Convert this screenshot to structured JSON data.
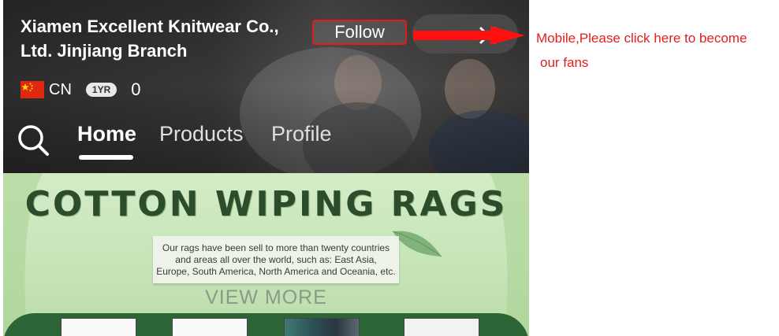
{
  "header": {
    "company_name": "Xiamen Excellent Knitwear Co., Ltd. Jinjiang Branch",
    "follow_label": "Follow",
    "country_code": "CN",
    "years_badge": "1YR",
    "fans_count": "0",
    "flag_icon": "china-flag-icon",
    "close_icon": "close-icon",
    "search_icon": "search-icon"
  },
  "tabs": [
    {
      "label": "Home",
      "active": true
    },
    {
      "label": "Products",
      "active": false
    },
    {
      "label": "Profile",
      "active": false
    }
  ],
  "banner": {
    "title": "COTTON WIPING RAGS",
    "description_lines": [
      "Our rags have been sell to more than twenty countries",
      "and areas all over the world, such as: East Asia,",
      "Europe, South America, North America and Oceania, etc."
    ],
    "view_more": "VIEW MORE"
  },
  "annotation": {
    "line1": "Mobile,Please click here to become",
    "line2": "our fans",
    "color": "#e31e1e"
  },
  "colors": {
    "follow_border": "#e21b1b",
    "banner_green": "#2e6536",
    "title_green": "#2c4d2c"
  }
}
